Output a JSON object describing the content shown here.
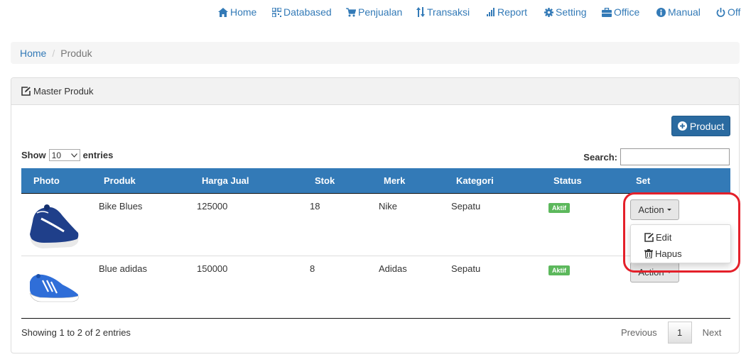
{
  "nav": {
    "home": "Home",
    "databased": "Databased",
    "penjualan": "Penjualan",
    "transaksi": "Transaksi",
    "report": "Report",
    "setting": "Setting",
    "office": "Office",
    "manual": "Manual",
    "off": "Off"
  },
  "breadcrumb": {
    "home": "Home",
    "current": "Produk"
  },
  "panel": {
    "title": "Master Produk"
  },
  "add_button": "Product",
  "length": {
    "prefix": "Show",
    "value": "10",
    "suffix": "entries"
  },
  "search": {
    "label": "Search:",
    "value": ""
  },
  "table": {
    "headers": [
      "Photo",
      "Produk",
      "Harga Jual",
      "Stok",
      "Merk",
      "Kategori",
      "Status",
      "Set"
    ],
    "rows": [
      {
        "produk": "Bike Blues",
        "harga": "125000",
        "stok": "18",
        "merk": "Nike",
        "kategori": "Sepatu",
        "status": "Aktif",
        "action": "Action"
      },
      {
        "produk": "Blue adidas",
        "harga": "150000",
        "stok": "8",
        "merk": "Adidas",
        "kategori": "Sepatu",
        "status": "Aktif",
        "action": "Action"
      }
    ]
  },
  "dropdown": {
    "edit": "Edit",
    "hapus": "Hapus"
  },
  "footer": {
    "info": "Showing 1 to 2 of 2 entries",
    "previous": "Previous",
    "page": "1",
    "next": "Next"
  },
  "colors": {
    "primary": "#337ab7",
    "button_dark": "#2a6aa0",
    "success": "#5cb85c",
    "highlight": "#e4202a"
  }
}
